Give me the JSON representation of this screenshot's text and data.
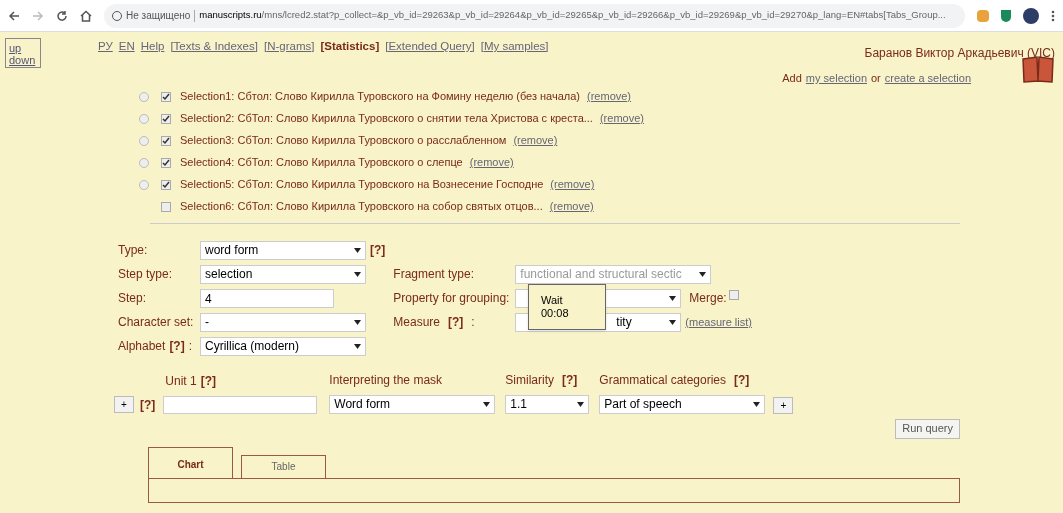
{
  "browser": {
    "security": "Не защищено",
    "url_host": "manuscripts.ru",
    "url_rest": "/mns/lcred2.stat?p_collect=&p_vb_id=29263&p_vb_id=29264&p_vb_id=29265&p_vb_id=29266&p_vb_id=29269&p_vb_id=29270&p_lang=EN#tabs[Tabs_Group..."
  },
  "side": {
    "up": "up",
    "down": "down"
  },
  "nav": [
    {
      "label": "РУ",
      "selected": false
    },
    {
      "label": "EN",
      "selected": false
    },
    {
      "label": "Help",
      "selected": false
    },
    {
      "label": "[Texts & Indexes]",
      "selected": false
    },
    {
      "label": "[N-grams]",
      "selected": false
    },
    {
      "label": "[Statistics]",
      "selected": true
    },
    {
      "label": "[Extended Query]",
      "selected": false
    },
    {
      "label": "[My samples]",
      "selected": false
    }
  ],
  "user": "Баранов Виктор Аркадьевич (VIC)",
  "add_line": {
    "prefix": "Add",
    "link1": "my selection",
    "middle": "or",
    "link2": "create a selection"
  },
  "selections": [
    {
      "radio": {
        "selected": false
      },
      "checked": true,
      "label": "Selection1: Сбтол: Слово Кирилла Туровского на Фомину неделю (без начала)",
      "remove": "(remove)"
    },
    {
      "radio": {
        "selected": false
      },
      "checked": true,
      "label": "Selection2: СбТол: Слово Кирилла Туровского о снятии тела Христова с креста...",
      "remove": "(remove)"
    },
    {
      "radio": {
        "selected": false
      },
      "checked": true,
      "label": "Selection3: СбТол: Слово Кирилла Туровского о расслабленном",
      "remove": "(remove)"
    },
    {
      "radio": {
        "selected": false
      },
      "checked": true,
      "label": "Selection4: СбТол: Слово Кирилла Туровского о слепце",
      "remove": "(remove)"
    },
    {
      "radio": {
        "selected": false
      },
      "checked": true,
      "label": "Selection5: СбТол: Слово Кирилла Туровского на Вознесение Господне",
      "remove": "(remove)"
    },
    {
      "checked": false,
      "label": "Selection6: СбТол: Слово Кирилла Туровского на собор святых отцов...",
      "remove": "(remove)"
    }
  ],
  "form": {
    "type": {
      "label": "Type:",
      "value": "word form",
      "help": "[?]"
    },
    "step_type": {
      "label": "Step type:",
      "value": "selection"
    },
    "step": {
      "label": "Step:",
      "value": "4"
    },
    "character_set": {
      "label": "Character set:",
      "value": "-"
    },
    "alphabet": {
      "label": "Alphabet",
      "help": "[?]",
      "colon": ":",
      "value": "Cyrillica (modern)"
    },
    "fragment_type": {
      "label": "Fragment type:",
      "value": "functional and structural sectic",
      "disabled": true
    },
    "grouping": {
      "label": "Property for grouping:"
    },
    "merge": {
      "label": "Merge:",
      "checked": false
    },
    "measure": {
      "label": "Measure",
      "help": "[?]",
      "colon": ":",
      "value": "tity",
      "link": "(measure list)"
    }
  },
  "wait": {
    "title": "Wait",
    "time": "00:08"
  },
  "unit": {
    "label": "Unit 1",
    "help": "[?]",
    "plus": "+",
    "help2": "[?]"
  },
  "mask": {
    "label": "Interpreting the mask",
    "value": "Word form"
  },
  "similarity": {
    "label": "Similarity",
    "help": "[?]",
    "value": "1.1"
  },
  "grammar": {
    "label": "Grammatical categories",
    "help": "[?]",
    "value": "Part of speech",
    "plus": "+"
  },
  "run": "Run query",
  "tabs": [
    {
      "label": "Chart",
      "selected": true
    },
    {
      "label": "Table",
      "selected": false
    }
  ]
}
